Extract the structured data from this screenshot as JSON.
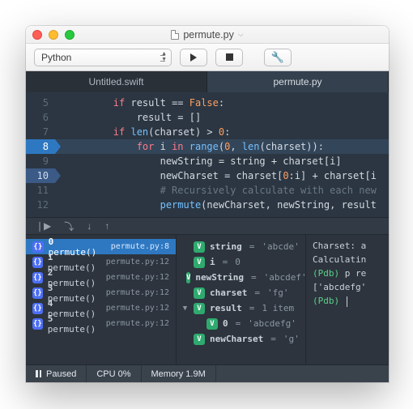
{
  "window": {
    "filename": "permute.py"
  },
  "toolbar": {
    "language": "Python"
  },
  "tabs": [
    {
      "label": "Untitled.swift",
      "active": false
    },
    {
      "label": "permute.py",
      "active": true
    }
  ],
  "editor": {
    "lines": [
      {
        "n": 5,
        "tokens": [
          [
            "",
            2
          ],
          [
            "if ",
            "kw"
          ],
          [
            "result ",
            "ident"
          ],
          [
            "== ",
            "punct"
          ],
          [
            "False",
            "const"
          ],
          [
            ":",
            "punct"
          ]
        ]
      },
      {
        "n": 6,
        "tokens": [
          [
            "",
            3
          ],
          [
            "result ",
            "ident"
          ],
          [
            "= []",
            "punct"
          ]
        ]
      },
      {
        "n": 7,
        "tokens": [
          [
            "",
            2
          ],
          [
            "if ",
            "kw"
          ],
          [
            "len",
            "func"
          ],
          [
            "(charset) > ",
            "punct"
          ],
          [
            "0",
            "num"
          ],
          [
            ":",
            "punct"
          ]
        ]
      },
      {
        "n": 8,
        "current": true,
        "tokens": [
          [
            "",
            3
          ],
          [
            "for ",
            "kw"
          ],
          [
            "i ",
            "ident"
          ],
          [
            "in ",
            "kw"
          ],
          [
            "range",
            "func"
          ],
          [
            "(",
            "punct"
          ],
          [
            "0",
            "num"
          ],
          [
            ", ",
            "punct"
          ],
          [
            "len",
            "func"
          ],
          [
            "(charset)):",
            "punct"
          ]
        ]
      },
      {
        "n": 9,
        "tokens": [
          [
            "",
            4
          ],
          [
            "newString = string + charset[i]",
            "punct"
          ]
        ]
      },
      {
        "n": 10,
        "bp": true,
        "tokens": [
          [
            "",
            4
          ],
          [
            "newCharset = charset[",
            "punct"
          ],
          [
            "0",
            "num"
          ],
          [
            ":i] + charset[i",
            "punct"
          ]
        ]
      },
      {
        "n": 11,
        "tokens": [
          [
            "",
            4
          ],
          [
            "# Recursively calculate with each new",
            "cmt"
          ]
        ]
      },
      {
        "n": 12,
        "tokens": [
          [
            "",
            4
          ],
          [
            "permute",
            "func"
          ],
          [
            "(newCharset, newString, result",
            "punct"
          ]
        ]
      }
    ]
  },
  "callstack": [
    {
      "n": 0,
      "fn": "permute()",
      "loc": "permute.py:8",
      "active": true
    },
    {
      "n": 1,
      "fn": "permute()",
      "loc": "permute.py:12"
    },
    {
      "n": 2,
      "fn": "permute()",
      "loc": "permute.py:12"
    },
    {
      "n": 3,
      "fn": "permute()",
      "loc": "permute.py:12"
    },
    {
      "n": 4,
      "fn": "permute()",
      "loc": "permute.py:12"
    },
    {
      "n": 5,
      "fn": "permute()",
      "loc": "permute.py:12"
    }
  ],
  "vars": [
    {
      "name": "string",
      "value": "'abcde'"
    },
    {
      "name": "i",
      "value": "0"
    },
    {
      "name": "newString",
      "value": "'abcdef'"
    },
    {
      "name": "charset",
      "value": "'fg'"
    },
    {
      "name": "result",
      "value": "1 item",
      "expanded": true,
      "children": [
        {
          "name": "0",
          "value": "'abcdefg'"
        }
      ]
    },
    {
      "name": "newCharset",
      "value": "'g'",
      "cut": true
    }
  ],
  "console": {
    "lines": [
      {
        "plain": "Charset: a"
      },
      {
        "plain": "Calculatin"
      },
      {
        "prompt": "(Pdb)",
        "rest": " p re"
      },
      {
        "plain": "['abcdefg'"
      },
      {
        "prompt": "(Pdb)",
        "rest": " ",
        "cursor": true
      }
    ]
  },
  "status": {
    "state": "Paused",
    "cpu": "CPU 0%",
    "mem": "Memory 1.9M"
  }
}
